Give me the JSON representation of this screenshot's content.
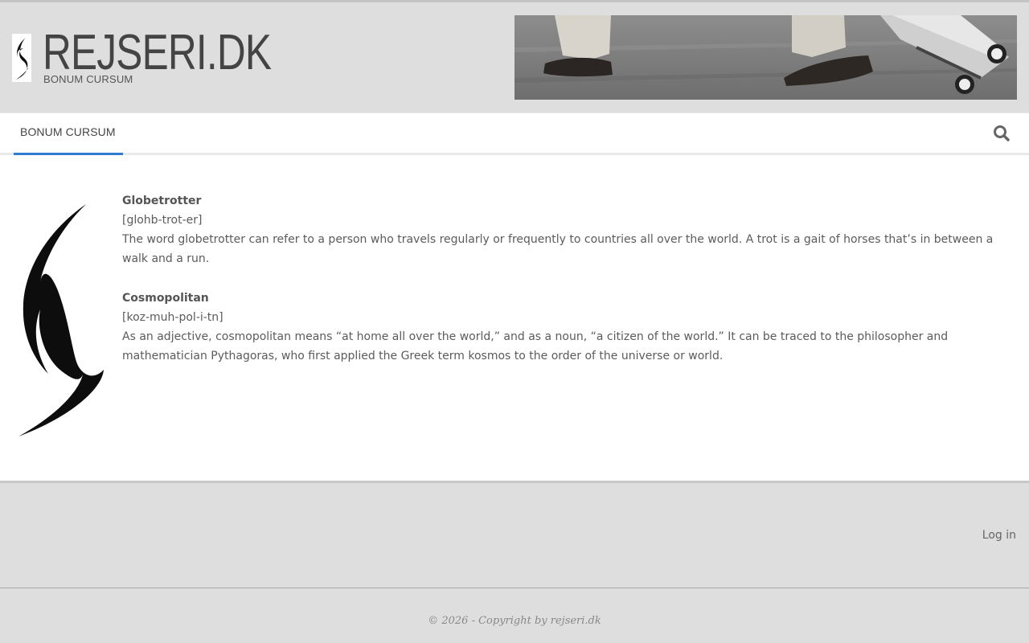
{
  "header": {
    "site_title": "REJSERI.DK",
    "tagline": "BONUM CURSUM",
    "logo_icon": "crescent-swirl-logo-icon",
    "banner_image": "feet-with-suitcase-banner"
  },
  "nav": {
    "items": [
      {
        "label": "BONUM CURSUM",
        "active": true
      }
    ],
    "search_icon": "search-icon",
    "accent_color": "#2f7bd0"
  },
  "content": {
    "entries": [
      {
        "term": "Globetrotter",
        "pronunciation": "[glohb-trot-er]",
        "definition": "The word globetrotter can refer to a person who travels regularly or frequently to countries all over the world. A trot is a gait of horses that’s in between a walk and a run."
      },
      {
        "term": "Cosmopolitan",
        "pronunciation": "[koz-muh-pol-i-tn]",
        "definition": "As an adjective, cosmopolitan means “at home all over the world,” and as a noun, “a citizen of the world.” It can be traced to the philosopher and mathematician Pythagoras, who first applied the Greek term kosmos to the order of the universe or world."
      }
    ]
  },
  "footer": {
    "login_label": "Log in",
    "copyright": "© 2026 - Copyright by rejseri.dk"
  }
}
